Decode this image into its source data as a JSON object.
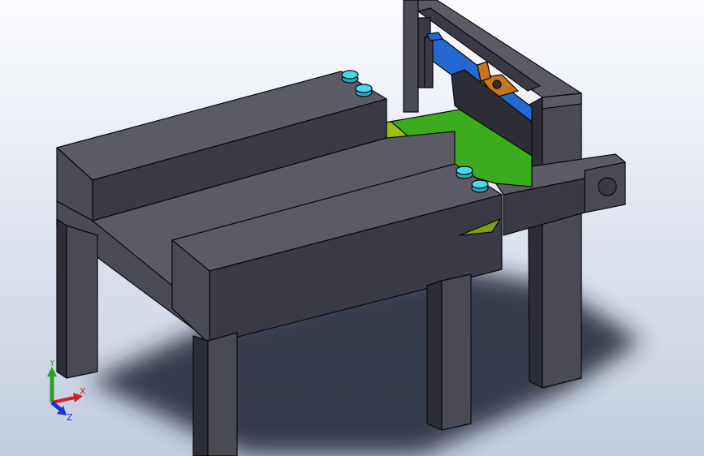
{
  "viewport": {
    "background_top": "#fbfcfe",
    "background_bottom": "#c3cde0"
  },
  "colors": {
    "body_light": "#5b5b66",
    "body_mid": "#4a4a54",
    "body_dark": "#3a3a44",
    "body_darker": "#2d2d35",
    "edge": "#0a0a0a",
    "shadow": "#1e2235",
    "plate_green": "#3cac1e",
    "plate_lime": "#9bbd1c",
    "plate_lime_dark": "#7ea014",
    "rail_blue": "#2468d0",
    "clamp_orange": "#c8741a",
    "knob_cyan": "#48d8ec",
    "axis_x": "#d42020",
    "axis_y": "#2aa02a",
    "axis_z": "#2030c8"
  },
  "triad": {
    "x_label": "X",
    "y_label": "Y",
    "z_label": "Z"
  }
}
